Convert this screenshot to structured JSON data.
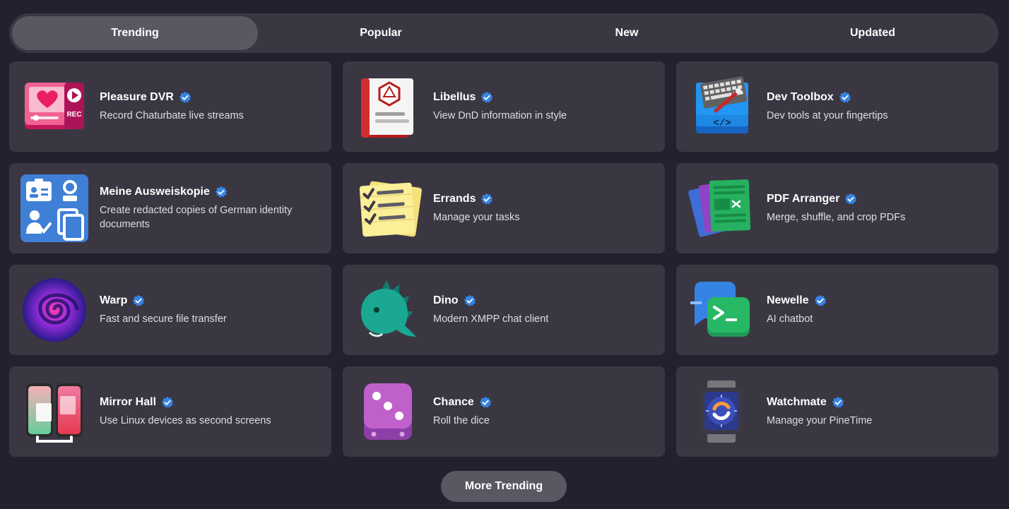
{
  "tabs": [
    {
      "label": "Trending",
      "active": true
    },
    {
      "label": "Popular",
      "active": false
    },
    {
      "label": "New",
      "active": false
    },
    {
      "label": "Updated",
      "active": false
    }
  ],
  "apps": [
    {
      "name": "Pleasure DVR",
      "description": "Record Chaturbate live streams",
      "icon": "pleasure-dvr-icon",
      "verified": true
    },
    {
      "name": "Libellus",
      "description": "View DnD information in style",
      "icon": "libellus-icon",
      "verified": true
    },
    {
      "name": "Dev Toolbox",
      "description": "Dev tools at your fingertips",
      "icon": "dev-toolbox-icon",
      "verified": true
    },
    {
      "name": "Meine Ausweiskopie",
      "description": "Create redacted copies of German identity documents",
      "icon": "meine-ausweiskopie-icon",
      "verified": true
    },
    {
      "name": "Errands",
      "description": "Manage your tasks",
      "icon": "errands-icon",
      "verified": true
    },
    {
      "name": "PDF Arranger",
      "description": "Merge, shuffle, and crop PDFs",
      "icon": "pdf-arranger-icon",
      "verified": true
    },
    {
      "name": "Warp",
      "description": "Fast and secure file transfer",
      "icon": "warp-icon",
      "verified": true
    },
    {
      "name": "Dino",
      "description": "Modern XMPP chat client",
      "icon": "dino-icon",
      "verified": true
    },
    {
      "name": "Newelle",
      "description": "AI chatbot",
      "icon": "newelle-icon",
      "verified": true
    },
    {
      "name": "Mirror Hall",
      "description": "Use Linux devices as second screens",
      "icon": "mirror-hall-icon",
      "verified": true
    },
    {
      "name": "Chance",
      "description": "Roll the dice",
      "icon": "chance-icon",
      "verified": true
    },
    {
      "name": "Watchmate",
      "description": "Manage your PineTime",
      "icon": "watchmate-icon",
      "verified": true
    }
  ],
  "more_button": {
    "label": "More Trending"
  },
  "colors": {
    "background": "#242030",
    "card": "#3a3743",
    "active_tab": "#5a5762",
    "verified": "#3584e4"
  }
}
